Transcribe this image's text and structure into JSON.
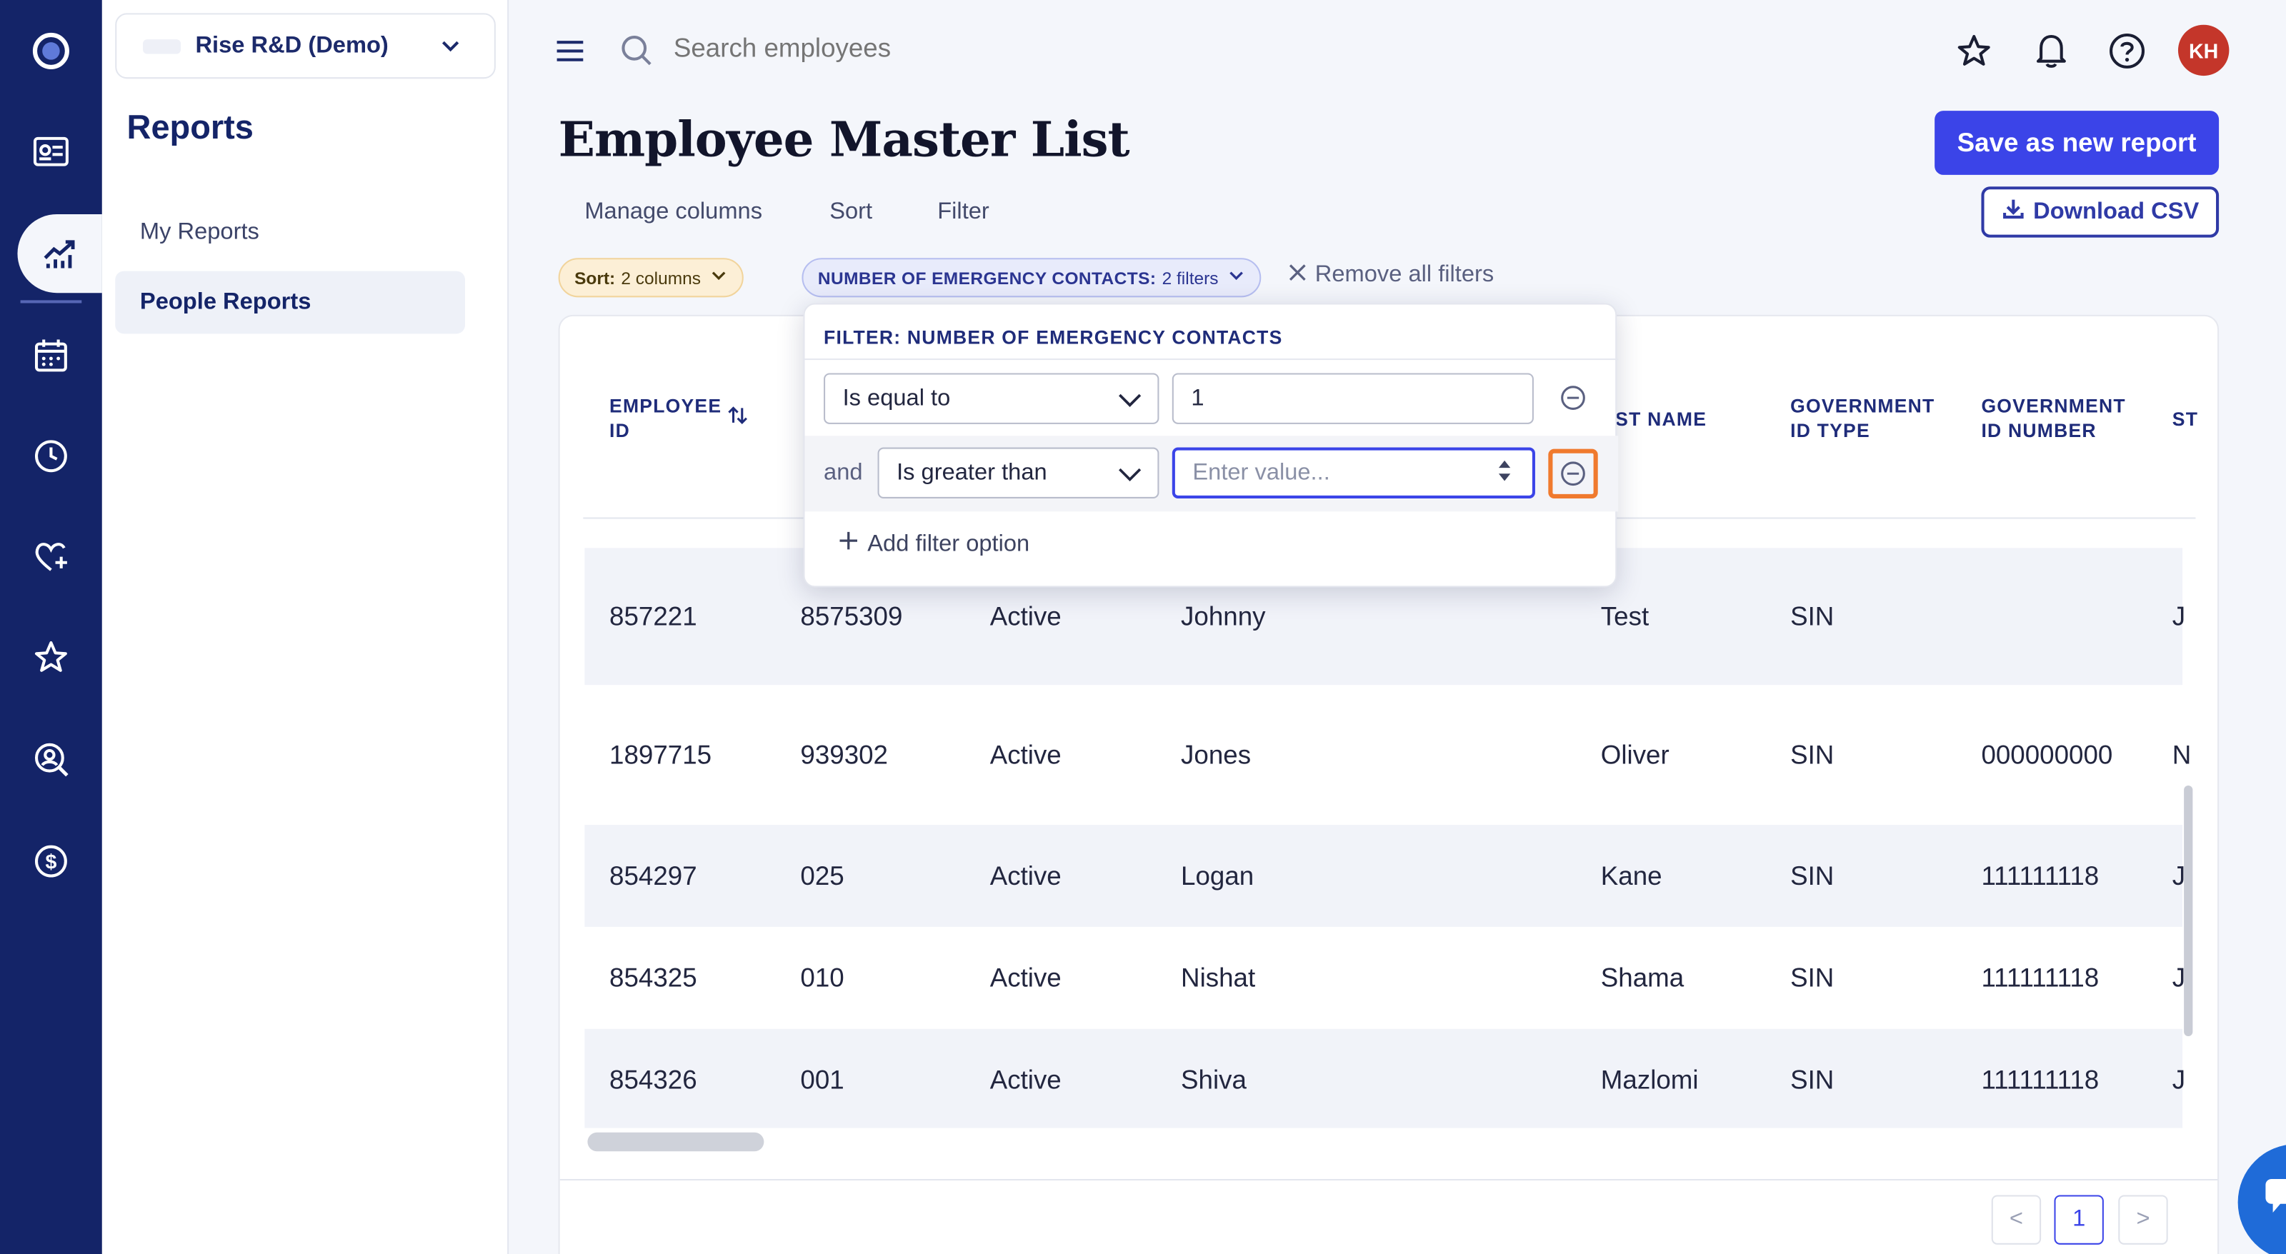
{
  "company": {
    "name": "Rise R&D (Demo)"
  },
  "sidebar": {
    "title": "Reports",
    "items": [
      {
        "label": "My Reports",
        "active": false
      },
      {
        "label": "People Reports",
        "active": true
      }
    ]
  },
  "topbar": {
    "search_placeholder": "Search employees",
    "avatar_initials": "KH"
  },
  "page": {
    "title": "Employee Master List",
    "save_label": "Save as new report",
    "download_label": "Download CSV"
  },
  "tools": {
    "manage": "Manage columns",
    "sort": "Sort",
    "filter": "Filter"
  },
  "chips": {
    "sort_key": "Sort:",
    "sort_val": "2 columns",
    "filter_key": "NUMBER OF EMERGENCY CONTACTS:",
    "filter_val": "2 filters",
    "remove_all": "Remove all filters"
  },
  "popover": {
    "title": "FILTER: NUMBER OF EMERGENCY CONTACTS",
    "cond1_op": "Is equal to",
    "cond1_val": "1",
    "and_label": "and",
    "cond2_op": "Is greater than",
    "cond2_placeholder": "Enter value...",
    "add_label": "Add filter option"
  },
  "table": {
    "headers": {
      "employee_id": [
        "EMPLOYEE",
        "ID"
      ],
      "last_name_partial": "AST NAME",
      "gov_id_type": [
        "GOVERNMENT",
        "ID TYPE"
      ],
      "gov_id_number": [
        "GOVERNMENT",
        "ID NUMBER"
      ],
      "st_partial": "ST"
    },
    "rows": [
      {
        "id": "857221",
        "num": "8575309",
        "status": "Active",
        "first": "Johnny",
        "last": "Test",
        "type": "SIN",
        "gov": "",
        "tail": "J"
      },
      {
        "id": "1897715",
        "num": "939302",
        "status": "Active",
        "first": "Jones",
        "last": "Oliver",
        "type": "SIN",
        "gov": "000000000",
        "tail": "N"
      },
      {
        "id": "854297",
        "num": "025",
        "status": "Active",
        "first": "Logan",
        "last": "Kane",
        "type": "SIN",
        "gov": "111111118",
        "tail": "J"
      },
      {
        "id": "854325",
        "num": "010",
        "status": "Active",
        "first": "Nishat",
        "last": "Shama",
        "type": "SIN",
        "gov": "111111118",
        "tail": "J"
      },
      {
        "id": "854326",
        "num": "001",
        "status": "Active",
        "first": "Shiva",
        "last": "Mazlomi",
        "type": "SIN",
        "gov": "111111118",
        "tail": "J"
      }
    ]
  },
  "pagination": {
    "prev": "<",
    "current": "1",
    "next": ">"
  },
  "colors": {
    "brand_navy": "#142468",
    "primary": "#3b44e8",
    "highlight": "#f07a2e",
    "avatar": "#c4362a"
  }
}
